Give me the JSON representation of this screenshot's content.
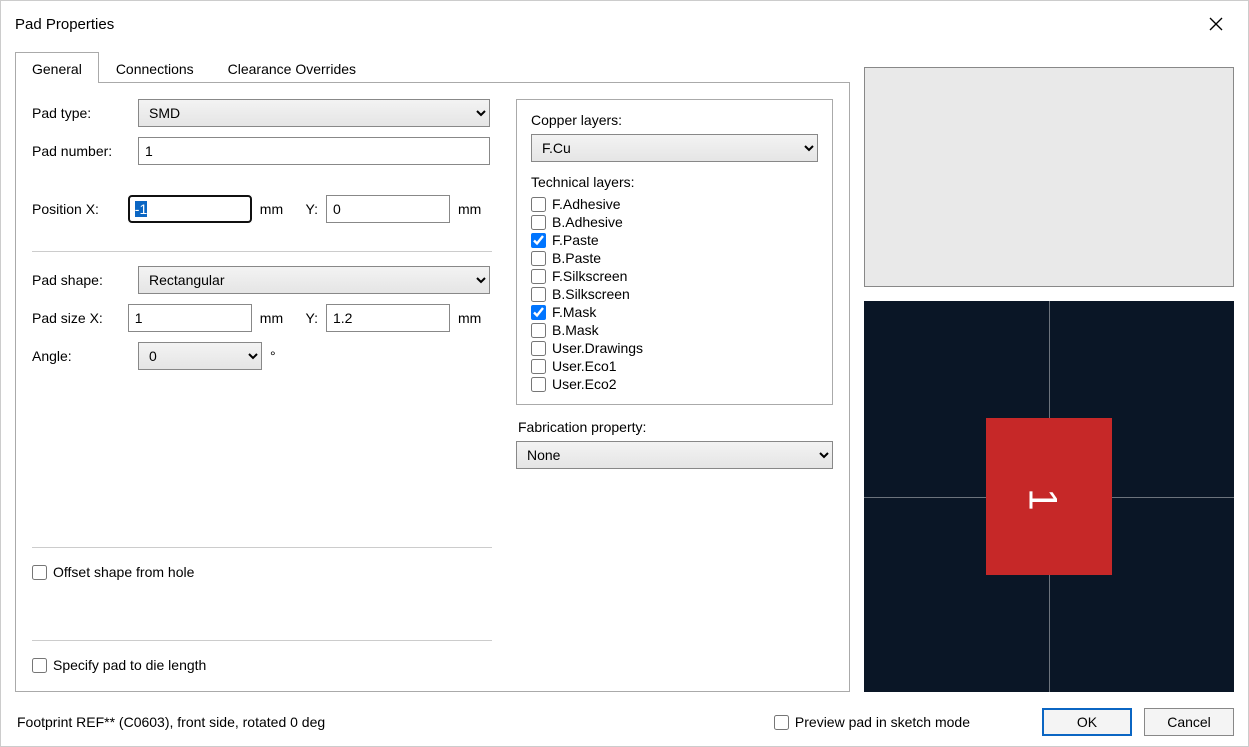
{
  "window_title": "Pad Properties",
  "tabs": [
    "General",
    "Connections",
    "Clearance Overrides"
  ],
  "active_tab": 0,
  "labels": {
    "pad_type": "Pad type:",
    "pad_number": "Pad number:",
    "position_x": "Position X:",
    "y": "Y:",
    "mm": "mm",
    "pad_shape": "Pad shape:",
    "pad_size_x": "Pad size X:",
    "angle": "Angle:",
    "deg": "°",
    "offset_shape": "Offset shape from hole",
    "specify_die": "Specify pad to die length",
    "copper_layers": "Copper layers:",
    "technical_layers": "Technical layers:",
    "fabrication_property": "Fabrication property:",
    "preview_sketch": "Preview pad in sketch mode",
    "ok": "OK",
    "cancel": "Cancel"
  },
  "values": {
    "pad_type": "SMD",
    "pad_number": "1",
    "pos_x": "-1",
    "pos_y": "0",
    "pad_shape": "Rectangular",
    "size_x": "1",
    "size_y": "1.2",
    "angle": "0",
    "copper_layer": "F.Cu",
    "fabrication": "None"
  },
  "technical_layers": [
    {
      "name": "F.Adhesive",
      "checked": false
    },
    {
      "name": "B.Adhesive",
      "checked": false
    },
    {
      "name": "F.Paste",
      "checked": true
    },
    {
      "name": "B.Paste",
      "checked": false
    },
    {
      "name": "F.Silkscreen",
      "checked": false
    },
    {
      "name": "B.Silkscreen",
      "checked": false
    },
    {
      "name": "F.Mask",
      "checked": true
    },
    {
      "name": "B.Mask",
      "checked": false
    },
    {
      "name": "User.Drawings",
      "checked": false
    },
    {
      "name": "User.Eco1",
      "checked": false
    },
    {
      "name": "User.Eco2",
      "checked": false
    }
  ],
  "checkboxes": {
    "offset_shape": false,
    "specify_die": false,
    "preview_sketch": false
  },
  "footer_status": "Footprint REF** (C0603), front side, rotated 0 deg",
  "colors": {
    "pad": "#c62828",
    "preview_bg": "#0a1626"
  }
}
